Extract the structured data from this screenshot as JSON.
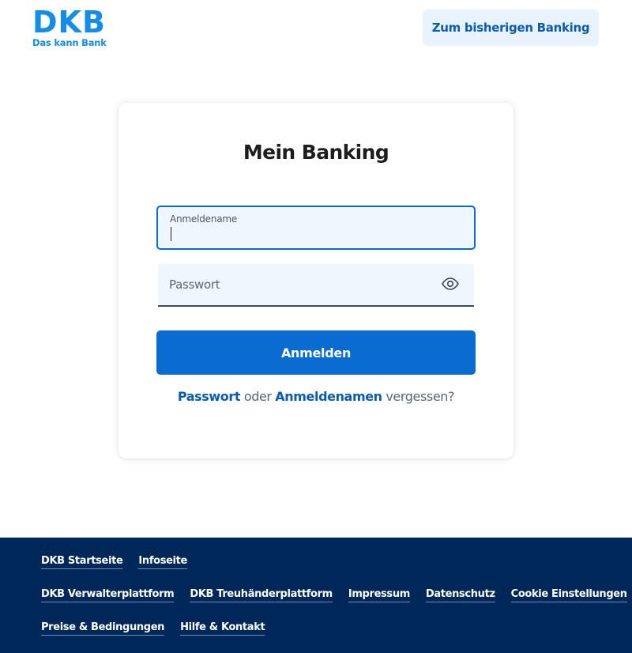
{
  "brand": {
    "logo_text": "DKB",
    "claim": "Das kann Bank",
    "primary_color": "#148dea",
    "button_color": "#0a6bd0",
    "footer_color": "#00275a"
  },
  "header": {
    "old_banking_label": "Zum bisherigen Banking"
  },
  "login": {
    "title": "Mein Banking",
    "username_label": "Anmeldename",
    "username_value": "",
    "password_placeholder": "Passwort",
    "password_value": "",
    "show_password_icon": "eye-icon",
    "submit_label": "Anmelden",
    "forgot": {
      "password_link": "Passwort",
      "or_text": "oder",
      "username_link": "Anmeldenamen",
      "suffix": "vergessen?"
    }
  },
  "footer": {
    "row1": [
      "DKB Startseite",
      "Infoseite"
    ],
    "row2": [
      "DKB Verwalterplattform",
      "DKB Treuhänderplattform",
      "Impressum",
      "Datenschutz",
      "Cookie Einstellungen"
    ],
    "row3": [
      "Preise & Bedingungen",
      "Hilfe & Kontakt"
    ]
  }
}
